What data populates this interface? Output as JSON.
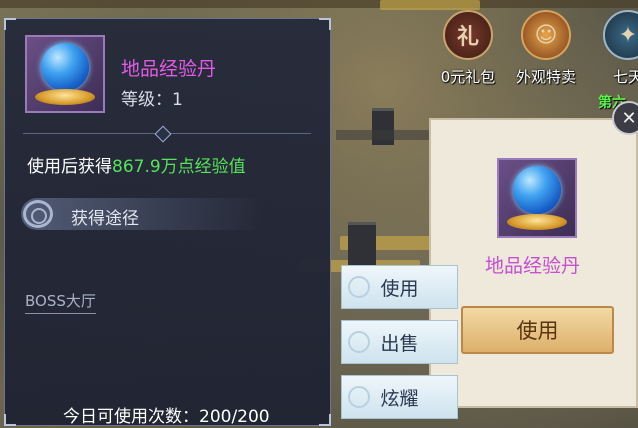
{
  "tooltip": {
    "item_name": "地品经验丹",
    "level_label": "等级：1",
    "use_gain_prefix": "使用后获得",
    "use_gain_value": "867.9万点经验值",
    "source_title": "获得途径",
    "source_link": "BOSS大厅",
    "daily_usage": "今日可使用次数：200/200"
  },
  "actions": {
    "use": "使用",
    "sell": "出售",
    "show_off": "炫耀"
  },
  "top_icons": [
    {
      "label": "0元礼包",
      "icon": "gift-icon",
      "glyph": "礼"
    },
    {
      "label": "外观特卖",
      "icon": "mask-icon",
      "glyph": "☺"
    },
    {
      "label": "七天",
      "icon": "seven-day-icon",
      "glyph": "✦"
    }
  ],
  "top_green_text": "第六",
  "right_panel": {
    "item_name": "地品经验丹",
    "use_button": "使用",
    "close_icon": "close-icon"
  },
  "colors": {
    "item_name": "#e25ae8",
    "exp_value": "#57e35a"
  }
}
